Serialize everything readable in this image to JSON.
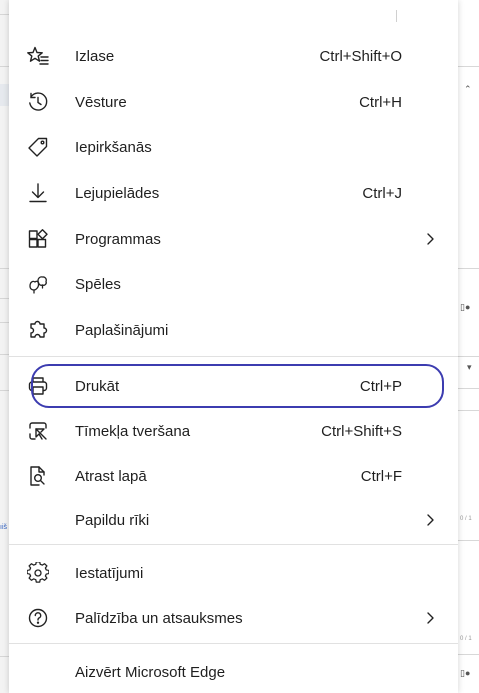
{
  "menu": {
    "items": [
      {
        "id": "favorites",
        "label": "Izlase",
        "shortcut": "Ctrl+Shift+O",
        "icon": "favorites-star-icon"
      },
      {
        "id": "history",
        "label": "Vēsture",
        "shortcut": "Ctrl+H",
        "icon": "history-clock-icon"
      },
      {
        "id": "shopping",
        "label": "Iepirkšanās",
        "shortcut": "",
        "icon": "shopping-tag-icon"
      },
      {
        "id": "downloads",
        "label": "Lejupielādes",
        "shortcut": "Ctrl+J",
        "icon": "download-icon"
      },
      {
        "id": "apps",
        "label": "Programmas",
        "shortcut": "",
        "icon": "apps-grid-icon",
        "submenu": true
      },
      {
        "id": "games",
        "label": "Spēles",
        "shortcut": "",
        "icon": "games-icon"
      },
      {
        "id": "extensions",
        "label": "Paplašinājumi",
        "shortcut": "",
        "icon": "extensions-puzzle-icon"
      },
      {
        "id": "print",
        "label": "Drukāt",
        "shortcut": "Ctrl+P",
        "icon": "printer-icon",
        "highlighted": true
      },
      {
        "id": "web-capture",
        "label": "Tīmekļa tveršana",
        "shortcut": "Ctrl+Shift+S",
        "icon": "web-capture-icon"
      },
      {
        "id": "find",
        "label": "Atrast lapā",
        "shortcut": "Ctrl+F",
        "icon": "find-on-page-icon"
      },
      {
        "id": "more-tools",
        "label": "Papildu rīki",
        "shortcut": "",
        "icon": "",
        "submenu": true
      },
      {
        "id": "settings",
        "label": "Iestatījumi",
        "shortcut": "",
        "icon": "gear-icon"
      },
      {
        "id": "help",
        "label": "Palīdzība un atsauksmes",
        "shortcut": "",
        "icon": "help-question-icon",
        "submenu": true
      },
      {
        "id": "close-edge",
        "label": "Aizvērt Microsoft Edge",
        "shortcut": "",
        "icon": ""
      }
    ]
  },
  "background": {
    "left_fragment": "ıiš",
    "right_fragment_1": "0 / 1",
    "right_fragment_2": "0 / 1"
  },
  "colors": {
    "highlight_border": "#3c3cb0",
    "separator": "#e1e1e1"
  }
}
